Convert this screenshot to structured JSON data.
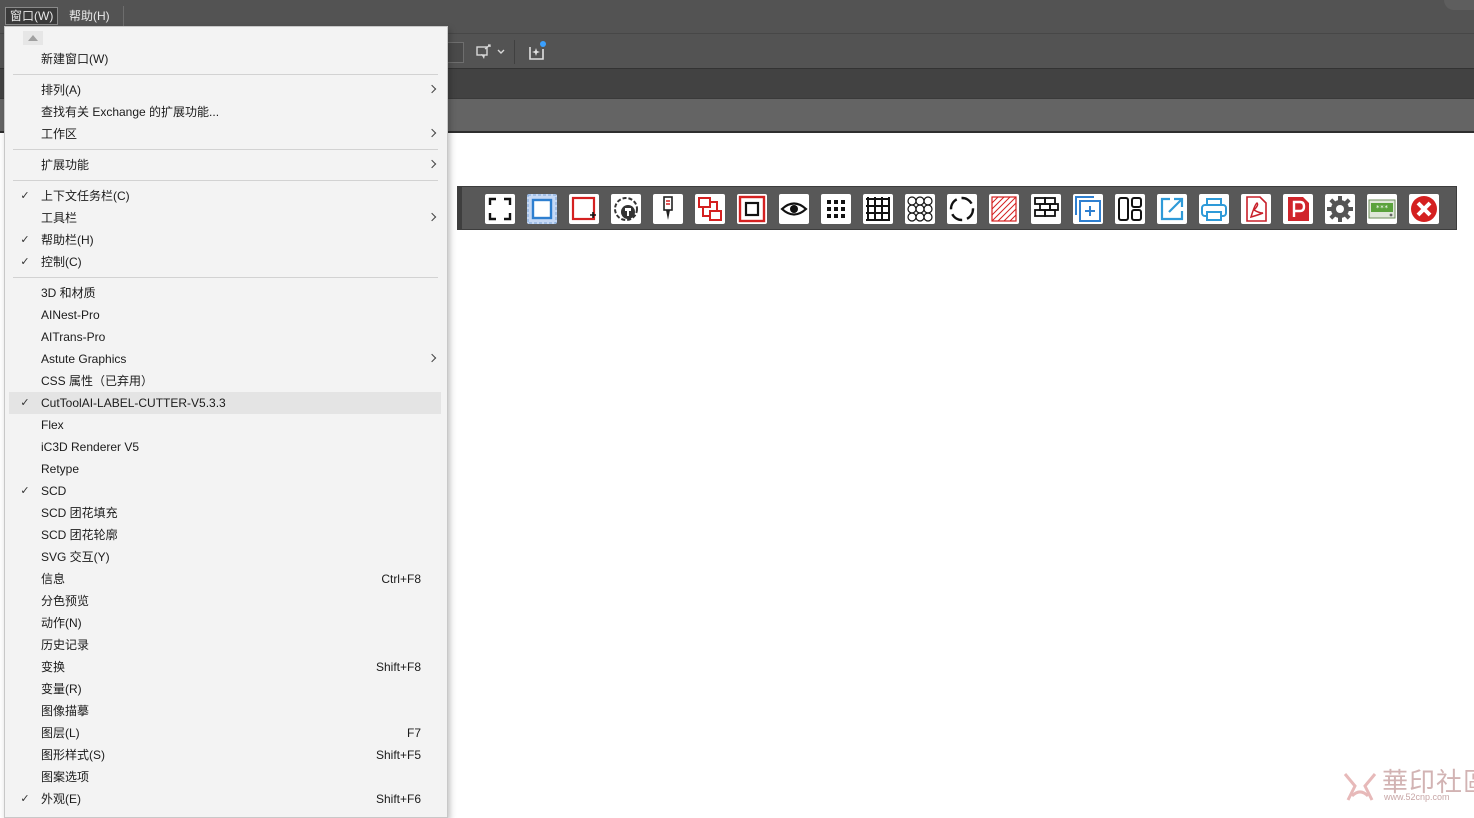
{
  "menubar": {
    "window": "窗口(W)",
    "help": "帮助(H)"
  },
  "menu": {
    "new_window": "新建窗口(W)",
    "arrange": "排列(A)",
    "find_exchange": "查找有关 Exchange 的扩展功能...",
    "workspace": "工作区",
    "extensions": "扩展功能",
    "context_taskbar": "上下文任务栏(C)",
    "toolbars": "工具栏",
    "help_bar": "帮助栏(H)",
    "control": "控制(C)",
    "plugins": [
      "3D 和材质",
      "AINest-Pro",
      "AITrans-Pro",
      "Astute Graphics",
      "CSS 属性（已弃用）",
      "CutToolAI-LABEL-CUTTER-V5.3.3",
      "Flex",
      "iC3D Renderer V5",
      "Retype",
      "SCD",
      "SCD 团花填充",
      "SCD 团花轮廓",
      "SVG 交互(Y)"
    ],
    "panels": [
      {
        "label": "信息",
        "shortcut": "Ctrl+F8"
      },
      {
        "label": "分色预览",
        "shortcut": ""
      },
      {
        "label": "动作(N)",
        "shortcut": ""
      },
      {
        "label": "历史记录",
        "shortcut": ""
      },
      {
        "label": "变换",
        "shortcut": "Shift+F8"
      },
      {
        "label": "变量(R)",
        "shortcut": ""
      },
      {
        "label": "图像描摹",
        "shortcut": ""
      },
      {
        "label": "图层(L)",
        "shortcut": "F7"
      },
      {
        "label": "图形样式(S)",
        "shortcut": "Shift+F5"
      },
      {
        "label": "图案选项",
        "shortcut": ""
      },
      {
        "label": "外观(E)",
        "shortcut": "Shift+F6"
      }
    ],
    "check_mark": "✓"
  },
  "cut_panel": {
    "icons": [
      "fullscreen-corners-icon",
      "select-frame-icon",
      "frame-add-point-icon",
      "mark-sensor-icon",
      "cutter-knife-icon",
      "contour-link-icon",
      "offset-frame-icon",
      "preview-eye-icon",
      "dot-matrix-icon",
      "grid-table-icon",
      "circles-grid-icon",
      "circle-marks-icon",
      "hatch-fill-icon",
      "brick-layout-icon",
      "add-layer-icon",
      "layout-blocks-icon",
      "export-arrow-icon",
      "printer-icon",
      "pdf-icon",
      "ppt-icon",
      "settings-gear-icon",
      "registration-key-icon",
      "close-x-icon"
    ],
    "accent_red": "#d42020",
    "accent_blue": "#2e7fd0"
  },
  "watermark": {
    "text": "華印社區",
    "url": "www.52cnp.com"
  }
}
